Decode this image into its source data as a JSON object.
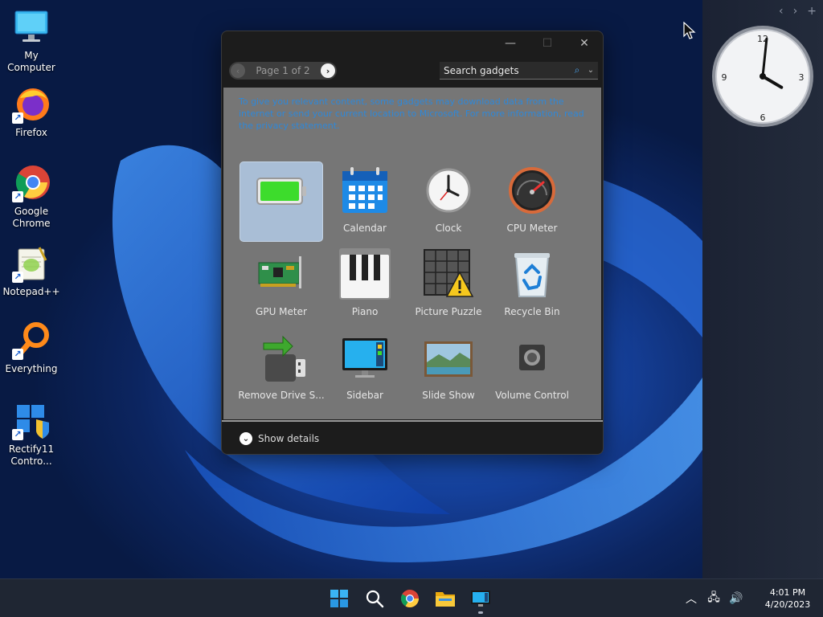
{
  "desktop": {
    "icons": [
      {
        "label": "My Computer"
      },
      {
        "label": "Firefox"
      },
      {
        "label": "Google Chrome"
      },
      {
        "label": "Notepad++"
      },
      {
        "label": "Everything"
      },
      {
        "label": "Rectify11 Contro..."
      }
    ]
  },
  "clock_gadget": {
    "numerals": [
      "12",
      "3",
      "6",
      "9"
    ],
    "time": "4:01"
  },
  "gadget_window": {
    "pager": {
      "label": "Page 1 of 2"
    },
    "search": {
      "placeholder": "Search gadgets"
    },
    "privacy_text": "To give you relevant content, some gadgets may download data from the internet or send your current location to Microsoft. For more information, read the privacy statement.",
    "gadgets": [
      {
        "name": "",
        "icon": "battery-icon",
        "selected": true
      },
      {
        "name": "Calendar",
        "icon": "calendar-icon"
      },
      {
        "name": "Clock",
        "icon": "clock-icon"
      },
      {
        "name": "CPU Meter",
        "icon": "cpu-meter-icon"
      },
      {
        "name": "GPU Meter",
        "icon": "gpu-card-icon"
      },
      {
        "name": "Piano",
        "icon": "piano-icon"
      },
      {
        "name": "Picture Puzzle",
        "icon": "picture-puzzle-icon"
      },
      {
        "name": "Recycle Bin",
        "icon": "recycle-bin-icon"
      },
      {
        "name": "Remove Drive S...",
        "icon": "usb-drive-icon"
      },
      {
        "name": "Sidebar",
        "icon": "sidebar-monitor-icon"
      },
      {
        "name": "Slide Show",
        "icon": "slide-show-icon"
      },
      {
        "name": "Volume Control",
        "icon": "speaker-icon"
      }
    ],
    "details_label": "Show details"
  },
  "taskbar": {
    "apps": [
      "start-icon",
      "search-icon",
      "chrome-icon",
      "file-explorer-icon",
      "gadgets-icon"
    ],
    "tray": {
      "time": "4:01 PM",
      "date": "4/20/2023"
    }
  },
  "colors": {
    "accent": "#2f88d8",
    "taskbar": "#1f2633",
    "gallery": "#767676"
  }
}
